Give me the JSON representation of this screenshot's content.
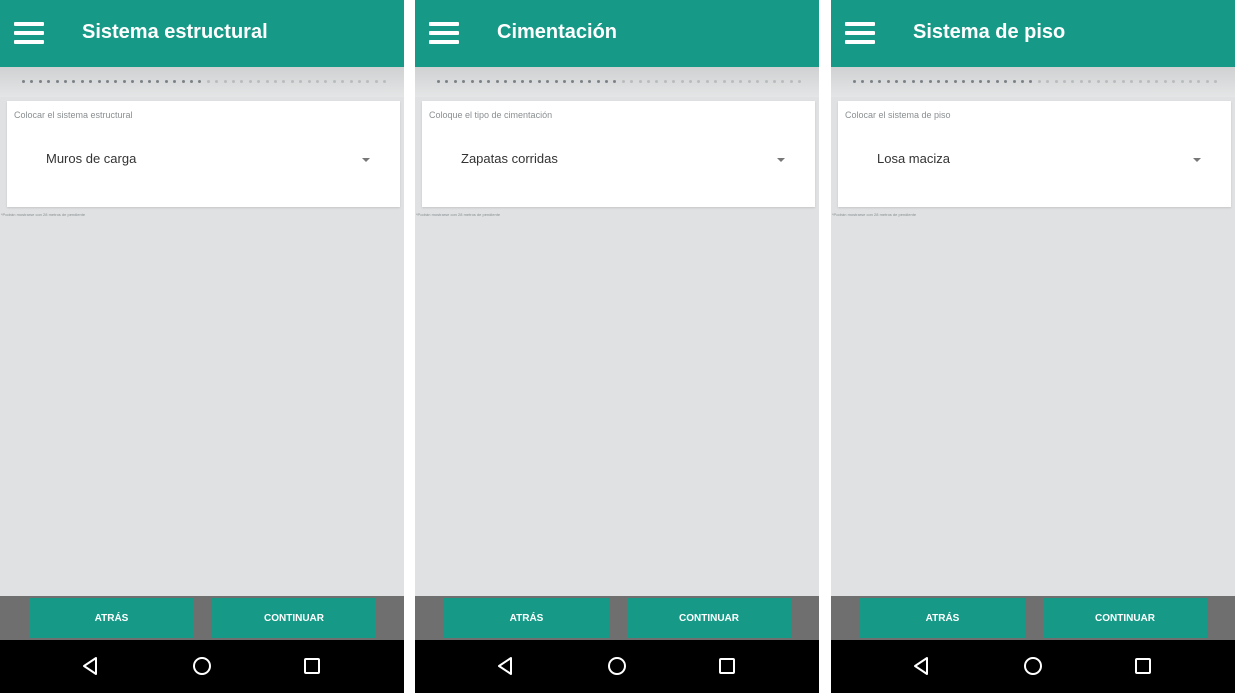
{
  "colors": {
    "accent": "#169a87",
    "background": "#dfe1e2",
    "nav_bar": "#000000",
    "button_bar": "#6f6f6f"
  },
  "screens": [
    {
      "title": "Sistema estructural",
      "menu_icon": "hamburger-menu-icon",
      "field_label": "Colocar el sistema estructural",
      "selected_value": "Muros de carga",
      "footnote": "*Podrán mostrarse con 28 metros de pendiente",
      "back_label": "ATRÁS",
      "next_label": "CONTINUAR",
      "nav_icons": [
        "back-triangle-icon",
        "home-circle-icon",
        "recent-apps-square-icon"
      ]
    },
    {
      "title": "Cimentación",
      "menu_icon": "hamburger-menu-icon",
      "field_label": "Coloque el tipo de cimentación",
      "selected_value": "Zapatas corridas",
      "footnote": "*Podrán mostrarse con 28 metros de pendiente",
      "back_label": "ATRÁS",
      "next_label": "CONTINUAR",
      "nav_icons": [
        "back-triangle-icon",
        "home-circle-icon",
        "recent-apps-square-icon"
      ]
    },
    {
      "title": "Sistema de piso",
      "menu_icon": "hamburger-menu-icon",
      "field_label": "Colocar el sistema de piso",
      "selected_value": "Losa maciza",
      "footnote": "*Podrán mostrarse con 28 metros de pendiente",
      "back_label": "ATRÁS",
      "next_label": "CONTINUAR",
      "nav_icons": [
        "back-triangle-icon",
        "home-circle-icon",
        "recent-apps-square-icon"
      ]
    }
  ]
}
